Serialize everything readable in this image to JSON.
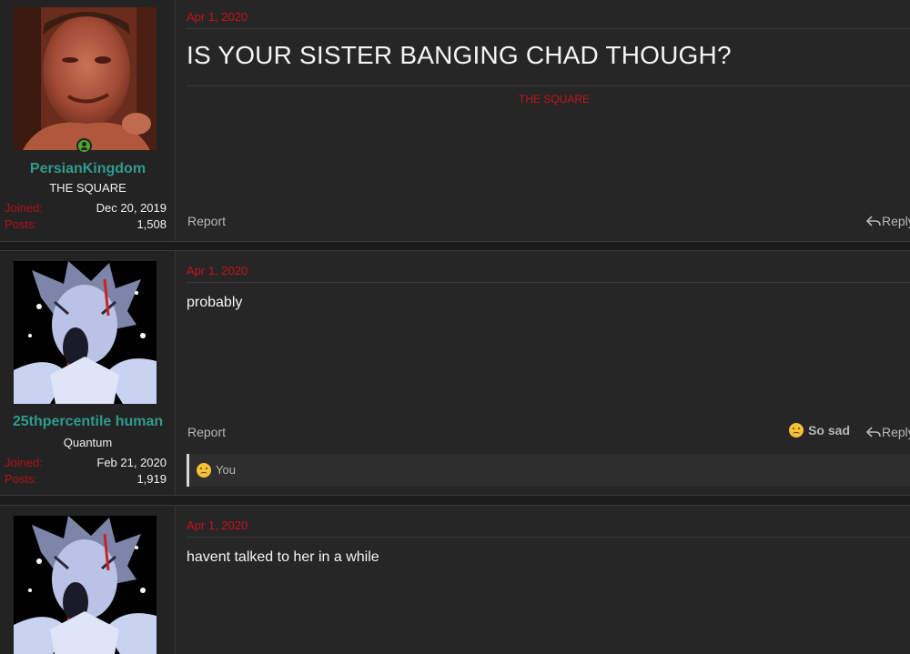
{
  "posts": [
    {
      "user": {
        "name": "PersianKingdom",
        "title": "THE SQUARE",
        "online": true,
        "joined_label": "Joined:",
        "joined": "Dec 20, 2019",
        "posts_label": "Posts:",
        "posts": "1,508"
      },
      "date": "Apr 1, 2020",
      "title": "IS YOUR SISTER BANGING CHAD THOUGH?",
      "signature": "THE SQUARE",
      "report": "Report",
      "reply": "Reply"
    },
    {
      "user": {
        "name": "25thpercentile human",
        "title": "Quantum",
        "joined_label": "Joined:",
        "joined": "Feb 21, 2020",
        "posts_label": "Posts:",
        "posts": "1,919"
      },
      "date": "Apr 1, 2020",
      "body": "probably",
      "report": "Report",
      "reaction_button": "So sad",
      "reply": "Reply",
      "reactions_by": "You"
    },
    {
      "date": "Apr 1, 2020",
      "body": "havent talked to her in a while"
    }
  ],
  "icons": {
    "online": "user-online-icon",
    "reply": "reply-arrow-icon",
    "sad": "sad-face-emoji-icon"
  },
  "colors": {
    "username": "#2e9c8c",
    "date": "#c7121c",
    "label": "#b0121a",
    "online": "#4aa82a"
  }
}
